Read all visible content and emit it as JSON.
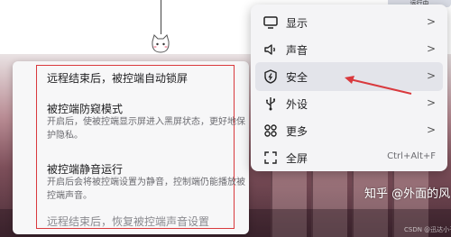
{
  "top_button": {
    "label": "运行中"
  },
  "panel": {
    "items": [
      {
        "title": "远程结束后，被控端自动锁屏",
        "desc": ""
      },
      {
        "title": "被控端防窥模式",
        "desc": "开启后，使被控端显示屏进入黑屏状态，更好地保护隐私。"
      },
      {
        "title": "被控端静音运行",
        "desc": "开启后会将被控端设置为静音，控制端仍能播放被控端声音。"
      },
      {
        "title": "远程结束后，恢复被控端声音设置",
        "desc": ""
      }
    ]
  },
  "menu": {
    "items": [
      {
        "label": "显示",
        "icon": "monitor-icon",
        "chevron": ">"
      },
      {
        "label": "声音",
        "icon": "speaker-icon",
        "chevron": ">"
      },
      {
        "label": "安全",
        "icon": "shield-icon",
        "chevron": ">"
      },
      {
        "label": "外设",
        "icon": "usb-icon",
        "chevron": ">"
      },
      {
        "label": "更多",
        "icon": "grid-icon",
        "chevron": ">"
      },
      {
        "label": "全屏",
        "icon": "fullscreen-icon",
        "shortcut": "Ctrl+Alt+F"
      }
    ],
    "selected_index": 2
  },
  "watermark": {
    "text": "知乎 @外面的风",
    "sub": "CSDN @迅达小子"
  },
  "colors": {
    "highlight_red": "#d9393d",
    "menu_bg": "#f4f4f6",
    "selected_bg": "#e3e4ea"
  }
}
